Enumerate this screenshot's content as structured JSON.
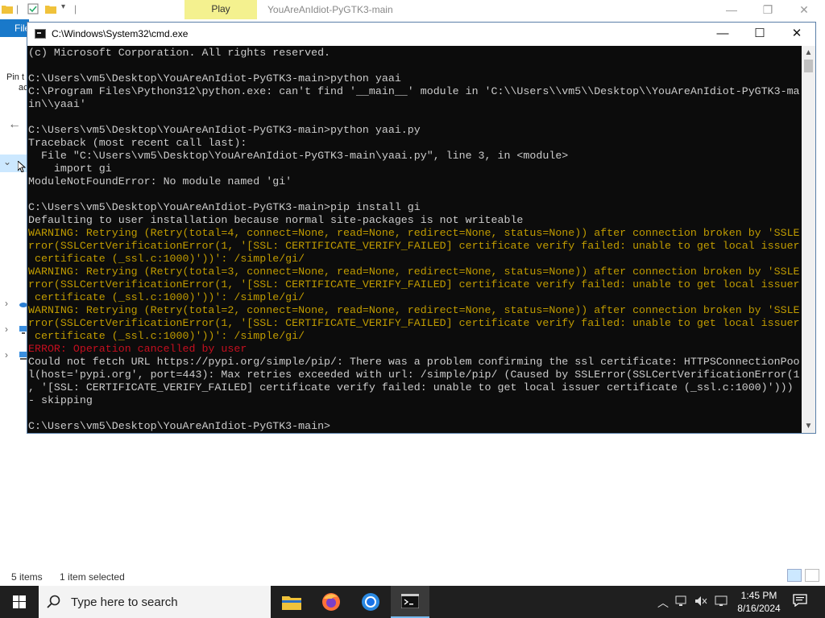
{
  "explorer": {
    "play_tab": "Play",
    "title": "YouAreAnIdiot-PyGTK3-main",
    "file_tab": "File",
    "pin_label_line1": "Pin t",
    "pin_label_line2": "ac",
    "status_items": "5 items",
    "status_selected": "1 item selected"
  },
  "cmd": {
    "title": "C:\\Windows\\System32\\cmd.exe",
    "lines": [
      {
        "text": "(c) Microsoft Corporation. All rights reserved.",
        "type": "normal"
      },
      {
        "text": "",
        "type": "normal"
      },
      {
        "text": "C:\\Users\\vm5\\Desktop\\YouAreAnIdiot-PyGTK3-main>python yaai",
        "type": "normal"
      },
      {
        "text": "C:\\Program Files\\Python312\\python.exe: can't find '__main__' module in 'C:\\\\Users\\\\vm5\\\\Desktop\\\\YouAreAnIdiot-PyGTK3-ma",
        "type": "normal"
      },
      {
        "text": "in\\\\yaai'",
        "type": "normal"
      },
      {
        "text": "",
        "type": "normal"
      },
      {
        "text": "C:\\Users\\vm5\\Desktop\\YouAreAnIdiot-PyGTK3-main>python yaai.py",
        "type": "normal"
      },
      {
        "text": "Traceback (most recent call last):",
        "type": "normal"
      },
      {
        "text": "  File \"C:\\Users\\vm5\\Desktop\\YouAreAnIdiot-PyGTK3-main\\yaai.py\", line 3, in <module>",
        "type": "normal"
      },
      {
        "text": "    import gi",
        "type": "normal"
      },
      {
        "text": "ModuleNotFoundError: No module named 'gi'",
        "type": "normal"
      },
      {
        "text": "",
        "type": "normal"
      },
      {
        "text": "C:\\Users\\vm5\\Desktop\\YouAreAnIdiot-PyGTK3-main>pip install gi",
        "type": "normal"
      },
      {
        "text": "Defaulting to user installation because normal site-packages is not writeable",
        "type": "normal"
      },
      {
        "text": "WARNING: Retrying (Retry(total=4, connect=None, read=None, redirect=None, status=None)) after connection broken by 'SSLE",
        "type": "warn"
      },
      {
        "text": "rror(SSLCertVerificationError(1, '[SSL: CERTIFICATE_VERIFY_FAILED] certificate verify failed: unable to get local issuer",
        "type": "warn"
      },
      {
        "text": " certificate (_ssl.c:1000)'))': /simple/gi/",
        "type": "warn"
      },
      {
        "text": "WARNING: Retrying (Retry(total=3, connect=None, read=None, redirect=None, status=None)) after connection broken by 'SSLE",
        "type": "warn"
      },
      {
        "text": "rror(SSLCertVerificationError(1, '[SSL: CERTIFICATE_VERIFY_FAILED] certificate verify failed: unable to get local issuer",
        "type": "warn"
      },
      {
        "text": " certificate (_ssl.c:1000)'))': /simple/gi/",
        "type": "warn"
      },
      {
        "text": "WARNING: Retrying (Retry(total=2, connect=None, read=None, redirect=None, status=None)) after connection broken by 'SSLE",
        "type": "warn"
      },
      {
        "text": "rror(SSLCertVerificationError(1, '[SSL: CERTIFICATE_VERIFY_FAILED] certificate verify failed: unable to get local issuer",
        "type": "warn"
      },
      {
        "text": " certificate (_ssl.c:1000)'))': /simple/gi/",
        "type": "warn"
      },
      {
        "text": "ERROR: Operation cancelled by user",
        "type": "err"
      },
      {
        "text": "Could not fetch URL https://pypi.org/simple/pip/: There was a problem confirming the ssl certificate: HTTPSConnectionPoo",
        "type": "normal"
      },
      {
        "text": "l(host='pypi.org', port=443): Max retries exceeded with url: /simple/pip/ (Caused by SSLError(SSLCertVerificationError(1",
        "type": "normal"
      },
      {
        "text": ", '[SSL: CERTIFICATE_VERIFY_FAILED] certificate verify failed: unable to get local issuer certificate (_ssl.c:1000)')))",
        "type": "normal"
      },
      {
        "text": "- skipping",
        "type": "normal"
      },
      {
        "text": "",
        "type": "normal"
      },
      {
        "text": "C:\\Users\\vm5\\Desktop\\YouAreAnIdiot-PyGTK3-main>",
        "type": "normal"
      }
    ]
  },
  "taskbar": {
    "search_placeholder": "Type here to search",
    "time": "1:45 PM",
    "date": "8/16/2024"
  },
  "colors": {
    "warning": "#c19c00",
    "error": "#c50f1f",
    "console_text": "#cccccc",
    "console_bg": "#0c0c0c",
    "taskbar_bg": "#1f1f1f",
    "file_tab": "#1979ca"
  },
  "icons": {
    "cmd": "cmd-window-icon",
    "start": "windows-logo-icon",
    "search": "search-icon",
    "explorer": "folder-icon",
    "firefox": "firefox-icon",
    "chrome": "chrome-icon",
    "terminal": "terminal-icon"
  }
}
